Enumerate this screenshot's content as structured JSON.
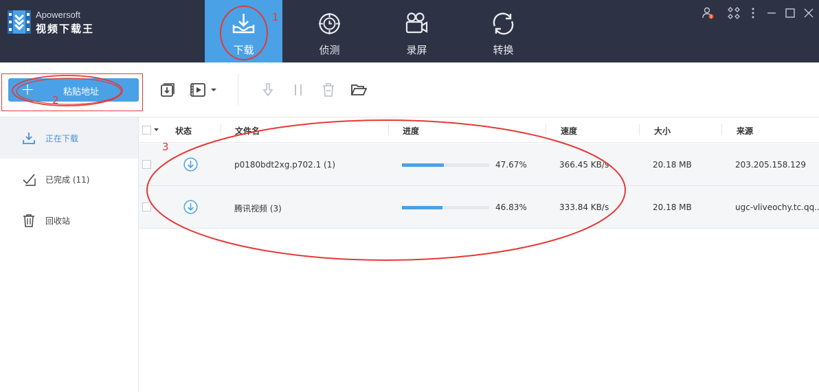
{
  "brand": {
    "name_en": "Apowersoft",
    "name_cn": "视频下载王",
    "accent": "#4aa1e6",
    "header_bg": "#2d3244"
  },
  "nav": {
    "tabs": [
      {
        "label": "下载",
        "icon": "download-tray-icon",
        "active": true
      },
      {
        "label": "侦测",
        "icon": "detect-icon",
        "active": false
      },
      {
        "label": "录屏",
        "icon": "video-camera-icon",
        "active": false
      },
      {
        "label": "转换",
        "icon": "convert-icon",
        "active": false
      }
    ]
  },
  "window_controls": [
    "user-alert-icon",
    "apps-icon",
    "more-icon",
    "minimize-icon",
    "maximize-icon",
    "close-icon"
  ],
  "toolbar": {
    "paste_label": "粘贴地址",
    "icons": [
      "batch-download-icon",
      "video-play-icon",
      "dropdown-arrow-icon",
      "start-icon",
      "pause-icon",
      "delete-icon",
      "open-folder-icon"
    ]
  },
  "sidebar": {
    "items": [
      {
        "label": "正在下载",
        "icon": "download-icon",
        "active": true
      },
      {
        "label": "已完成 (11)",
        "icon": "completed-check-icon",
        "active": false
      },
      {
        "label": "回收站",
        "icon": "trash-icon",
        "active": false
      }
    ]
  },
  "table": {
    "columns": [
      "状态",
      "文件名",
      "进度",
      "速度",
      "大小",
      "来源"
    ],
    "rows": [
      {
        "filename": "p0180bdt2xg.p702.1 (1)",
        "progress": 47.67,
        "progress_text": "47.67%",
        "speed": "366.45 KB/s",
        "size": "20.18 MB",
        "source": "203.205.158.129"
      },
      {
        "filename": "腾讯视频 (3)",
        "progress": 46.83,
        "progress_text": "46.83%",
        "speed": "333.84 KB/s",
        "size": "20.18 MB",
        "source": "ugc-vliveochy.tc.qq...."
      }
    ]
  },
  "annotations": {
    "one": "1",
    "two": "2",
    "three": "3",
    "color": "#e53935"
  }
}
